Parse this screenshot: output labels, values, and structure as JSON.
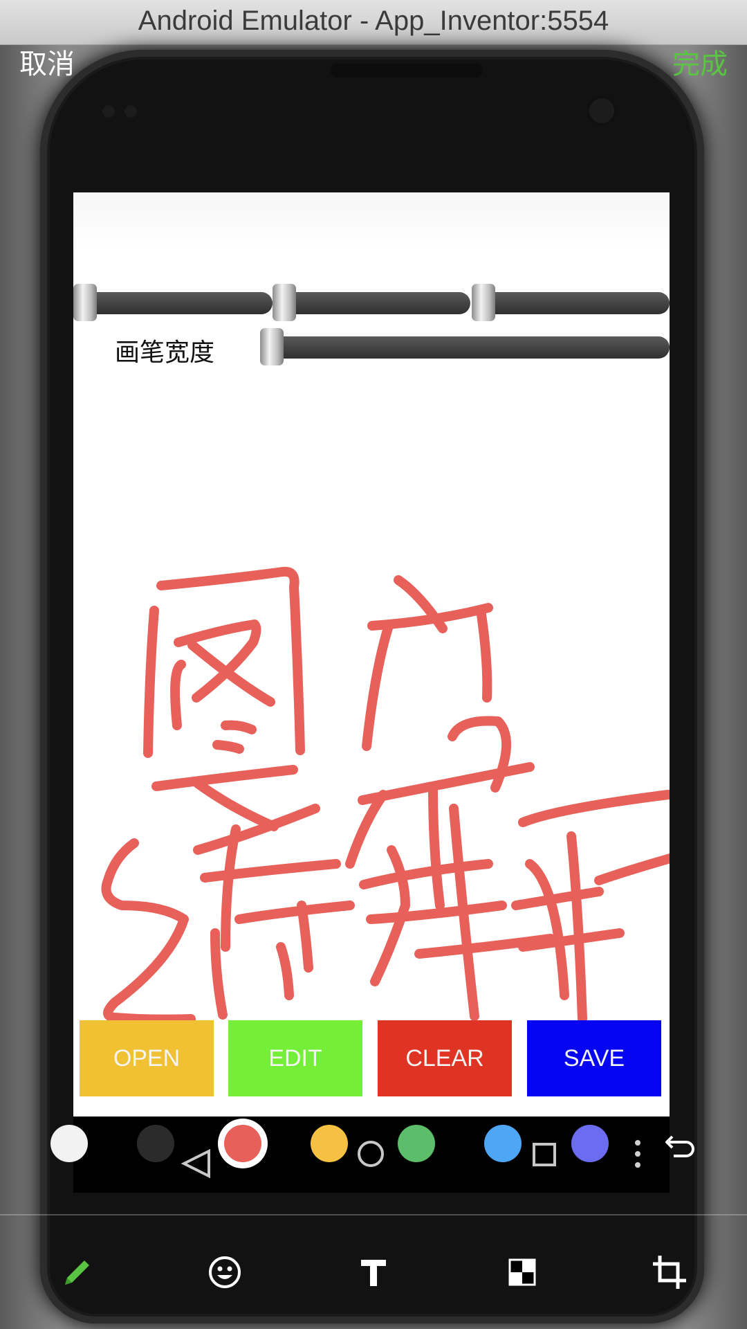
{
  "window": {
    "title": "Android Emulator - App_Inventor:5554"
  },
  "editor": {
    "cancel_label": "取消",
    "done_label": "完成",
    "accent_color": "#5ac443"
  },
  "app": {
    "brush_width_label": "画笔宽度",
    "sliders": [
      {
        "name": "red-slider",
        "level": 0
      },
      {
        "name": "green-slider",
        "level": 0
      },
      {
        "name": "blue-slider",
        "level": 0
      },
      {
        "name": "brush-width-slider",
        "level": 0
      }
    ],
    "buttons": [
      {
        "label": "OPEN",
        "color": "#f0c233"
      },
      {
        "label": "EDIT",
        "color": "#74ee37"
      },
      {
        "label": "CLEAR",
        "color": "#df3423"
      },
      {
        "label": "SAVE",
        "color": "#0505f1"
      }
    ]
  },
  "drawing": {
    "stroke_color": "#e8605a",
    "content": "handwritten strokes"
  },
  "palette": {
    "colors": [
      "#f2f2f2",
      "#2b2b2b",
      "#e8605a",
      "#f6c143",
      "#5cbd6b",
      "#4ea7f5",
      "#6b6cf0"
    ],
    "selected": 2
  },
  "toolbar": {
    "tools": [
      "pencil-icon",
      "emoji-icon",
      "text-icon",
      "mosaic-icon",
      "crop-icon"
    ],
    "active": 0
  }
}
